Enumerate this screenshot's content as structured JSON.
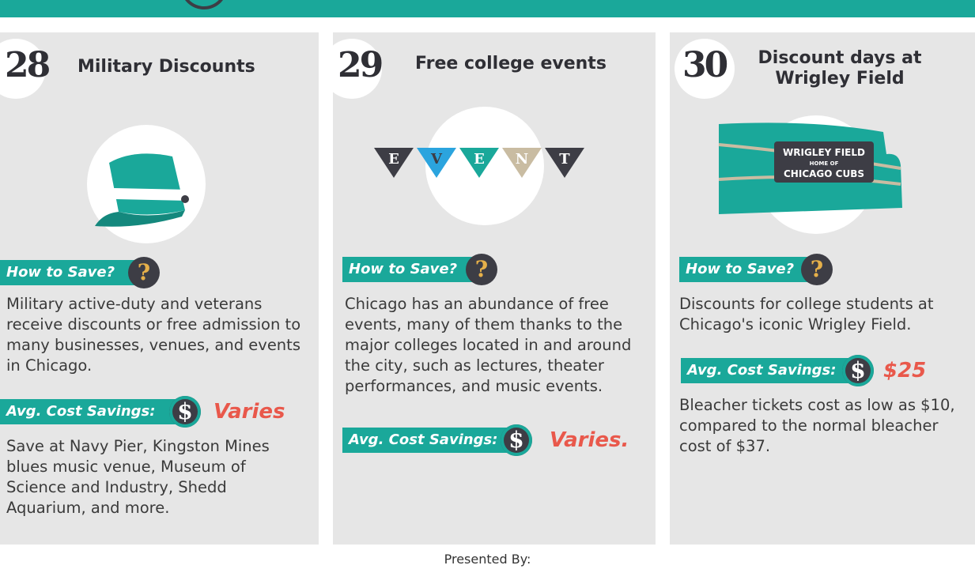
{
  "colors": {
    "teal": "#1aa89a",
    "dark": "#3d3d45",
    "red": "#e9584b",
    "card_bg": "#e6e6e6"
  },
  "cards": [
    {
      "number": "28",
      "title": "Military Discounts",
      "illustration": "military-cap-icon",
      "how_label": "How to Save?",
      "how_icon": "?",
      "description": "Military active-duty and veterans receive discounts or free admission to many businesses, venues, and events in Chicago.",
      "savings_label": "Avg. Cost Savings:",
      "savings_icon": "$",
      "savings_value": "Varies",
      "details": "Save at Navy Pier, Kingston Mines blues music venue, Museum of Science and Industry, Shedd Aquarium, and more."
    },
    {
      "number": "29",
      "title": "Free college events",
      "illustration": "event-banner-icon",
      "banner_letters": [
        "E",
        "V",
        "E",
        "N",
        "T"
      ],
      "how_label": "How to Save?",
      "how_icon": "?",
      "description": "Chicago has an abundance of free events, many of them thanks to the major colleges located in and around the city, such as lectures, theater performances, and music events.",
      "savings_label": "Avg. Cost Savings:",
      "savings_icon": "$",
      "savings_value": "Varies."
    },
    {
      "number": "30",
      "title_line1": "Discount days at",
      "title_line2": "Wrigley Field",
      "illustration": "wrigley-field-sign-icon",
      "sign_top": "WRIGLEY FIELD",
      "sign_mid": "HOME OF",
      "sign_bottom": "CHICAGO CUBS",
      "how_label": "How to Save?",
      "how_icon": "?",
      "description": "Discounts for college students at Chicago's iconic Wrigley Field.",
      "savings_label": "Avg. Cost Savings:",
      "savings_icon": "$",
      "savings_value": "$25",
      "details": "Bleacher tickets cost as low as $10, compared to the normal bleacher cost of $37."
    }
  ],
  "footer": {
    "presented_by": "Presented By:"
  }
}
